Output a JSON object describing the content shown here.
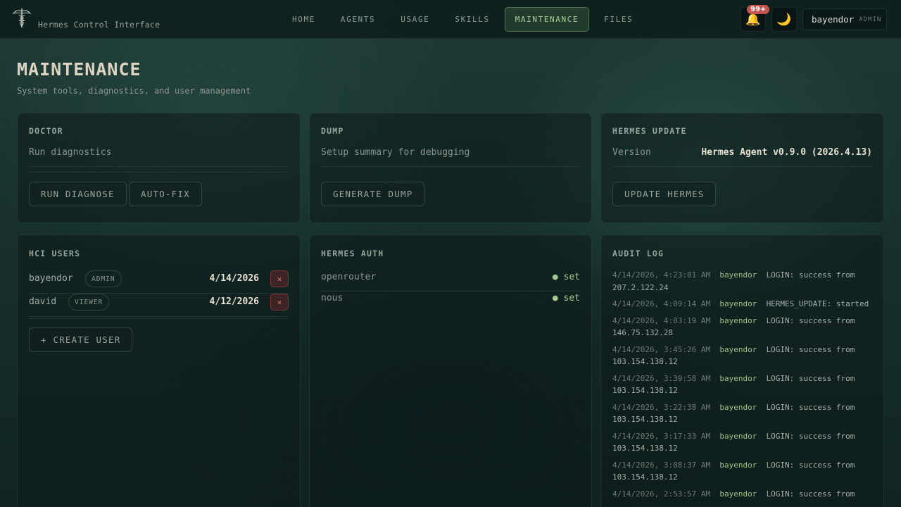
{
  "brand": {
    "subtitle": "Hermes Control Interface"
  },
  "nav": {
    "items": [
      "HOME",
      "AGENTS",
      "USAGE",
      "SKILLS",
      "MAINTENANCE",
      "FILES"
    ],
    "active": "MAINTENANCE"
  },
  "notifications": {
    "count": "99+"
  },
  "current_user": {
    "name": "bayendor",
    "role": "ADMIN"
  },
  "page": {
    "title": "MAINTENANCE",
    "subtitle": "System tools, diagnostics, and user management"
  },
  "doctor": {
    "title": "DOCTOR",
    "description": "Run diagnostics",
    "buttons": {
      "diagnose": "RUN DIAGNOSE",
      "autofix": "AUTO-FIX"
    }
  },
  "dump": {
    "title": "DUMP",
    "description": "Setup summary for debugging",
    "buttons": {
      "generate": "GENERATE DUMP"
    }
  },
  "update": {
    "title": "HERMES UPDATE",
    "version_label": "Version",
    "version_value": "Hermes Agent v0.9.0 (2026.4.13)",
    "buttons": {
      "update": "UPDATE HERMES"
    }
  },
  "hci_users": {
    "title": "HCI USERS",
    "users": [
      {
        "name": "bayendor",
        "role": "ADMIN",
        "date": "4/14/2026",
        "delete": "×"
      },
      {
        "name": "david",
        "role": "VIEWER",
        "date": "4/12/2026",
        "delete": "×"
      }
    ],
    "create_label": "+ CREATE USER"
  },
  "hermes_auth": {
    "title": "HERMES AUTH",
    "providers": [
      {
        "name": "openrouter",
        "status": "● set"
      },
      {
        "name": "nous",
        "status": "● set"
      }
    ]
  },
  "audit_log": {
    "title": "AUDIT LOG",
    "entries": [
      {
        "ts": "4/14/2026, 4:23:01 AM",
        "user": "bayendor",
        "msg": "LOGIN: success from 207.2.122.24"
      },
      {
        "ts": "4/14/2026, 4:09:14 AM",
        "user": "bayendor",
        "msg": "HERMES_UPDATE: started"
      },
      {
        "ts": "4/14/2026, 4:03:19 AM",
        "user": "bayendor",
        "msg": "LOGIN: success from 146.75.132.28"
      },
      {
        "ts": "4/14/2026, 3:45:26 AM",
        "user": "bayendor",
        "msg": "LOGIN: success from 103.154.138.12"
      },
      {
        "ts": "4/14/2026, 3:39:58 AM",
        "user": "bayendor",
        "msg": "LOGIN: success from 103.154.138.12"
      },
      {
        "ts": "4/14/2026, 3:22:38 AM",
        "user": "bayendor",
        "msg": "LOGIN: success from 103.154.138.12"
      },
      {
        "ts": "4/14/2026, 3:17:33 AM",
        "user": "bayendor",
        "msg": "LOGIN: success from 103.154.138.12"
      },
      {
        "ts": "4/14/2026, 3:08:37 AM",
        "user": "bayendor",
        "msg": "LOGIN: success from 103.154.138.12"
      },
      {
        "ts": "4/14/2026, 2:53:57 AM",
        "user": "bayendor",
        "msg": "LOGIN: success from"
      }
    ]
  },
  "icons": {
    "logo": "caduceus-icon",
    "notifications": "bell-icon",
    "theme": "moon-icon"
  }
}
